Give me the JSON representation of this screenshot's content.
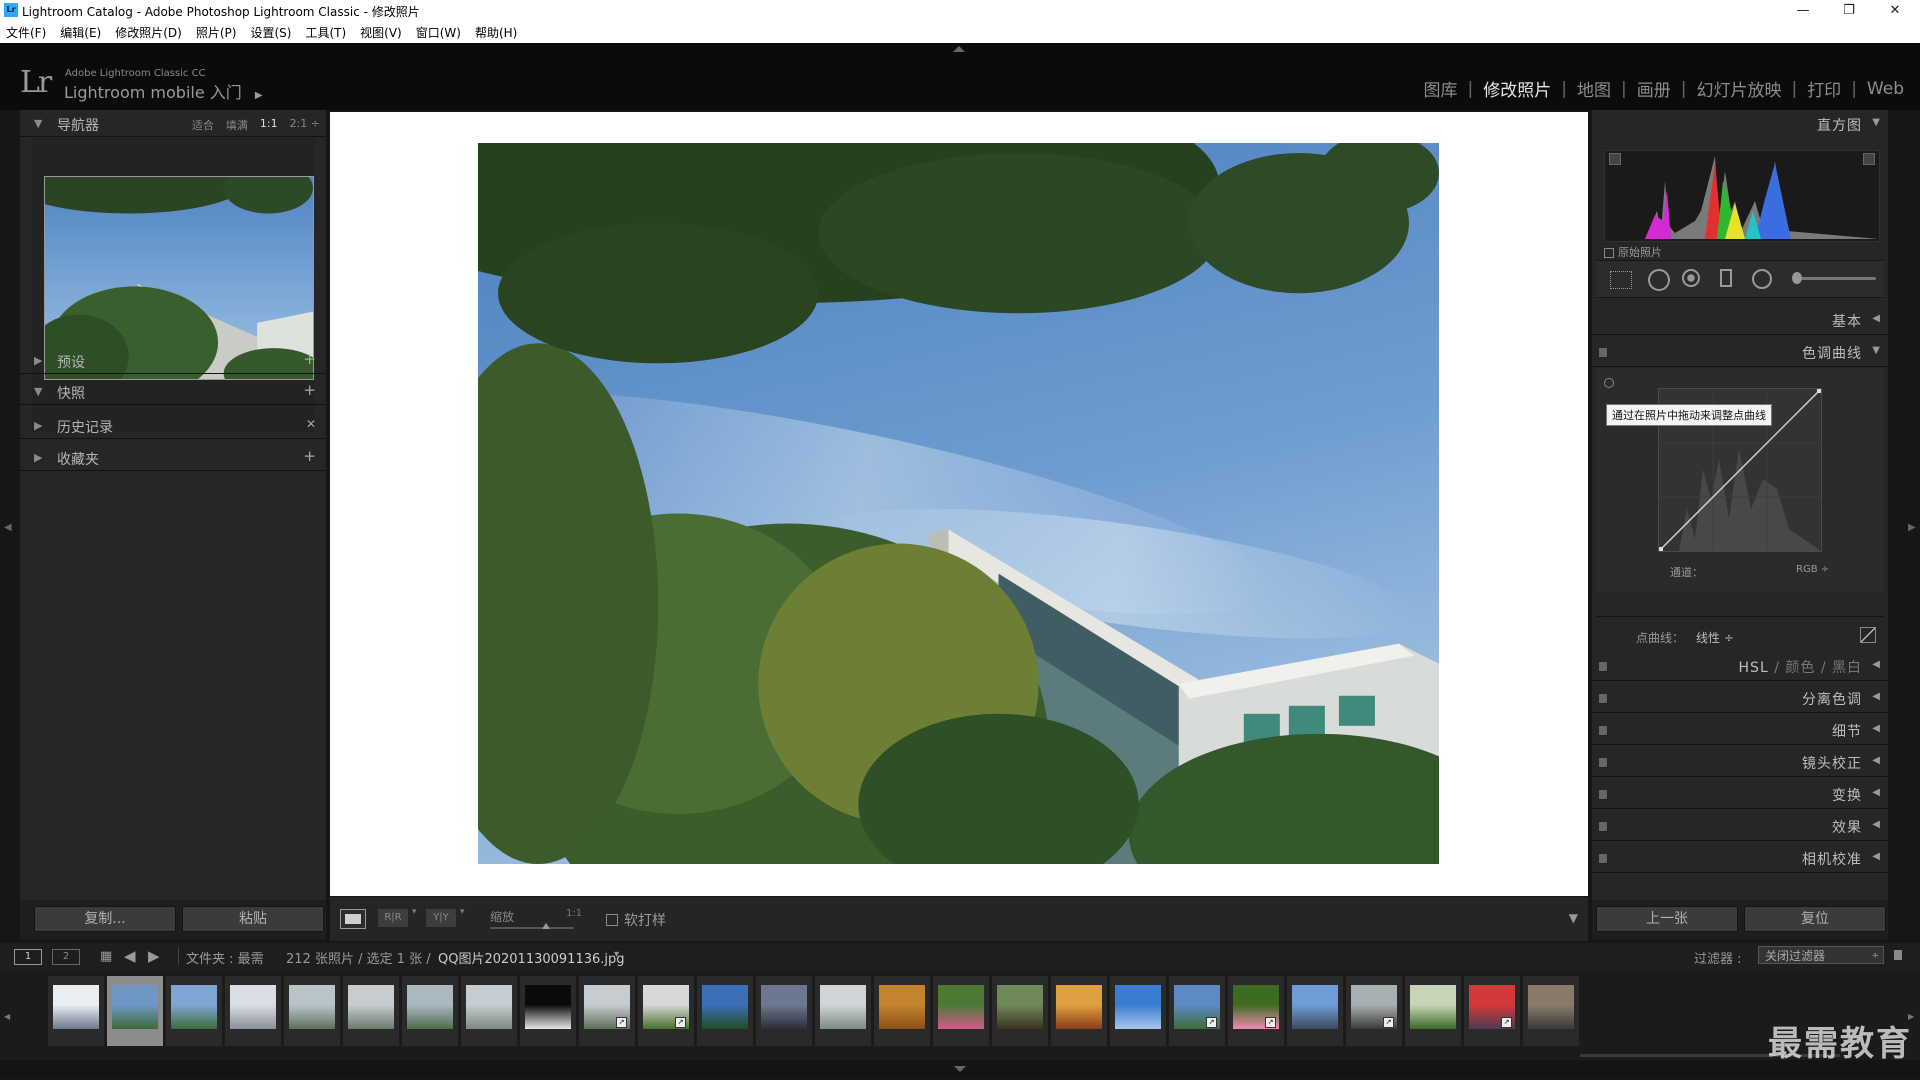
{
  "window": {
    "icon_text": "Lr",
    "title": "Lightroom Catalog - Adobe Photoshop Lightroom Classic - 修改照片",
    "controls": [
      "—",
      "❐",
      "✕"
    ]
  },
  "menubar": [
    "文件(F)",
    "编辑(E)",
    "修改照片(D)",
    "照片(P)",
    "设置(S)",
    "工具(T)",
    "视图(V)",
    "窗口(W)",
    "帮助(H)"
  ],
  "identity": {
    "logo": "Lr",
    "product": "Adobe Lightroom Classic CC",
    "mobile": "Lightroom mobile 入门",
    "arrow": "▶"
  },
  "modules": [
    {
      "label": "图库",
      "active": false
    },
    {
      "label": "修改照片",
      "active": true
    },
    {
      "label": "地图",
      "active": false
    },
    {
      "label": "画册",
      "active": false
    },
    {
      "label": "幻灯片放映",
      "active": false
    },
    {
      "label": "打印",
      "active": false
    },
    {
      "label": "Web",
      "active": false
    }
  ],
  "left_panel": {
    "navigator": {
      "title": "导航器",
      "zoom_options": [
        {
          "label": "适合",
          "active": false
        },
        {
          "label": "填满",
          "active": false
        },
        {
          "label": "1:1",
          "active": true
        },
        {
          "label": "2:1 ÷",
          "active": false
        }
      ]
    },
    "sections": [
      {
        "title": "预设",
        "expanded": false,
        "action": "+"
      },
      {
        "title": "快照",
        "expanded": true,
        "action": "+"
      },
      {
        "title": "历史记录",
        "expanded": false,
        "action": "✕"
      },
      {
        "title": "收藏夹",
        "expanded": false,
        "action": "+"
      }
    ],
    "copy_button": "复制...",
    "paste_button": "粘贴"
  },
  "toolbar": {
    "zoom_label": "缩放",
    "zoom_value": "1:1",
    "soft_proof": "软打样",
    "view_buttons": [
      "R|R",
      "Y|Y"
    ]
  },
  "right_panel": {
    "histogram_title": "直方图",
    "original_photo": "原始照片",
    "sections": {
      "basic": "基本",
      "tone_curve": "色调曲线",
      "hsl": "HSL",
      "color": "颜色",
      "bw": "黑白",
      "split_toning": "分离色调",
      "detail": "细节",
      "lens": "镜头校正",
      "transform": "变换",
      "effects": "效果",
      "calibration": "相机校准"
    },
    "curve_tooltip": "通过在照片中拖动来调整点曲线",
    "channel_label": "通道：",
    "channel_value": "RGB ÷",
    "point_curve_label": "点曲线：",
    "point_curve_value": "线性 ÷",
    "prev_button": "上一张",
    "reset_button": "复位"
  },
  "filmstrip_bar": {
    "page1": "1",
    "page2": "2",
    "source": "文件夹 : 最需",
    "count": "212 张照片 / 选定 1 张 /",
    "filename": "QQ图片20201130091136.jpg",
    "filter_label": "过滤器 :",
    "filter_value": "关闭过滤器"
  },
  "filmstrip": {
    "selected_index": 1,
    "thumbs": [
      {
        "colors": [
          "#e8eef2",
          "#6c7a8a"
        ],
        "badge": false
      },
      {
        "colors": [
          "#6d98c6",
          "#3f6a35"
        ],
        "badge": false
      },
      {
        "colors": [
          "#7ea6d2",
          "#3d6b3a"
        ],
        "badge": false
      },
      {
        "colors": [
          "#d9dde4",
          "#8a8f98"
        ],
        "badge": false
      },
      {
        "colors": [
          "#b9c4c9",
          "#5d6f5f"
        ],
        "badge": false
      },
      {
        "colors": [
          "#c7ccd0",
          "#6a7a6a"
        ],
        "badge": false
      },
      {
        "colors": [
          "#aab8c2",
          "#4f6b49"
        ],
        "badge": false
      },
      {
        "colors": [
          "#c5ccd2",
          "#7c8a7e"
        ],
        "badge": false
      },
      {
        "colors": [
          "#0b0b0b",
          "#e8e8e8"
        ],
        "badge": false
      },
      {
        "colors": [
          "#c6ccd0",
          "#5f6e5a"
        ],
        "badge": true
      },
      {
        "colors": [
          "#d8d8d8",
          "#4a6f2a"
        ],
        "badge": true
      },
      {
        "colors": [
          "#3d6eb8",
          "#224d22"
        ],
        "badge": false
      },
      {
        "colors": [
          "#6b7890",
          "#2c2d34"
        ],
        "badge": false
      },
      {
        "colors": [
          "#d0d4d6",
          "#7d8b80"
        ],
        "badge": false
      },
      {
        "colors": [
          "#c6832e",
          "#8a4f16"
        ],
        "badge": false
      },
      {
        "colors": [
          "#4c7a35",
          "#d45a8a"
        ],
        "badge": false
      },
      {
        "colors": [
          "#6f8a58",
          "#3d3222"
        ],
        "badge": false
      },
      {
        "colors": [
          "#e0a040",
          "#8b3c1a"
        ],
        "badge": false
      },
      {
        "colors": [
          "#3a7dd1",
          "#a9c6ec"
        ],
        "badge": false
      },
      {
        "colors": [
          "#5c8ac4",
          "#3f6b3a"
        ],
        "badge": true
      },
      {
        "colors": [
          "#3e6b22",
          "#f08ab0"
        ],
        "badge": true
      },
      {
        "colors": [
          "#6f9cd6",
          "#3b4a5e"
        ],
        "badge": false
      },
      {
        "colors": [
          "#a8b0b4",
          "#3d3a34"
        ],
        "badge": true
      },
      {
        "colors": [
          "#c8d4b8",
          "#3c6a28"
        ],
        "badge": false
      },
      {
        "colors": [
          "#d23a3a",
          "#4d3a52"
        ],
        "badge": true
      },
      {
        "colors": [
          "#8a7a6a",
          "#3a3a3a"
        ],
        "badge": false
      }
    ]
  },
  "watermark": "最需教育"
}
